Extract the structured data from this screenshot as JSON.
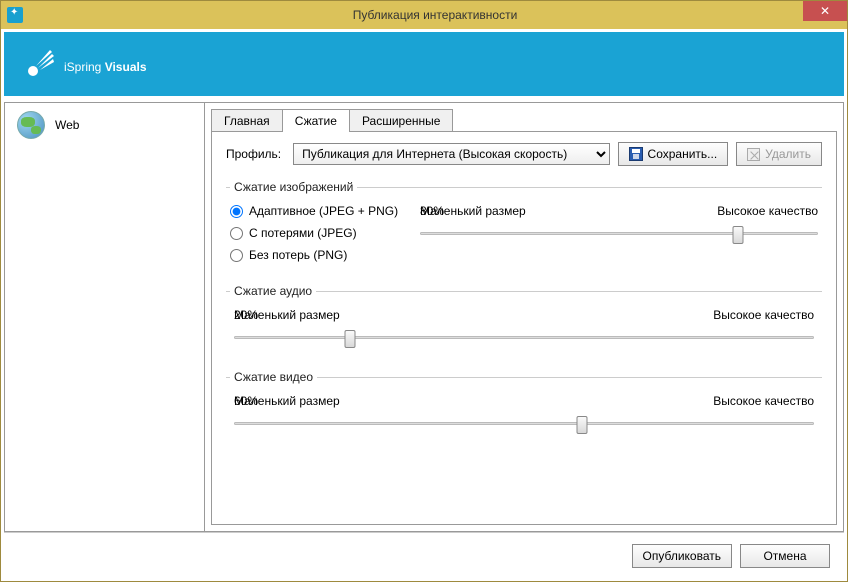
{
  "window": {
    "title": "Публикация интерактивности"
  },
  "brand": {
    "part1": "iSpring ",
    "part2": "Visuals"
  },
  "sidebar": {
    "items": [
      {
        "label": "Web"
      }
    ]
  },
  "tabs": {
    "items": [
      {
        "label": "Главная"
      },
      {
        "label": "Сжатие"
      },
      {
        "label": "Расширенные"
      }
    ],
    "active": 1
  },
  "profile": {
    "label": "Профиль:",
    "options": [
      "Публикация для Интернета (Высокая скорость)"
    ],
    "save": "Сохранить...",
    "delete": "Удалить"
  },
  "groups": {
    "image": {
      "legend": "Сжатие изображений",
      "radios": [
        "Адаптивное (JPEG + PNG)",
        "С потерями (JPEG)",
        "Без потерь (PNG)"
      ],
      "small": "Маленький размер",
      "high": "Высокое качество",
      "pct": "80%",
      "val": 80
    },
    "audio": {
      "legend": "Сжатие аудио",
      "small": "Маленький размер",
      "high": "Высокое качество",
      "pct": "20%",
      "val": 20
    },
    "video": {
      "legend": "Сжатие видео",
      "small": "Маленький размер",
      "high": "Высокое качество",
      "pct": "60%",
      "val": 60
    }
  },
  "footer": {
    "publish": "Опубликовать",
    "cancel": "Отмена"
  }
}
